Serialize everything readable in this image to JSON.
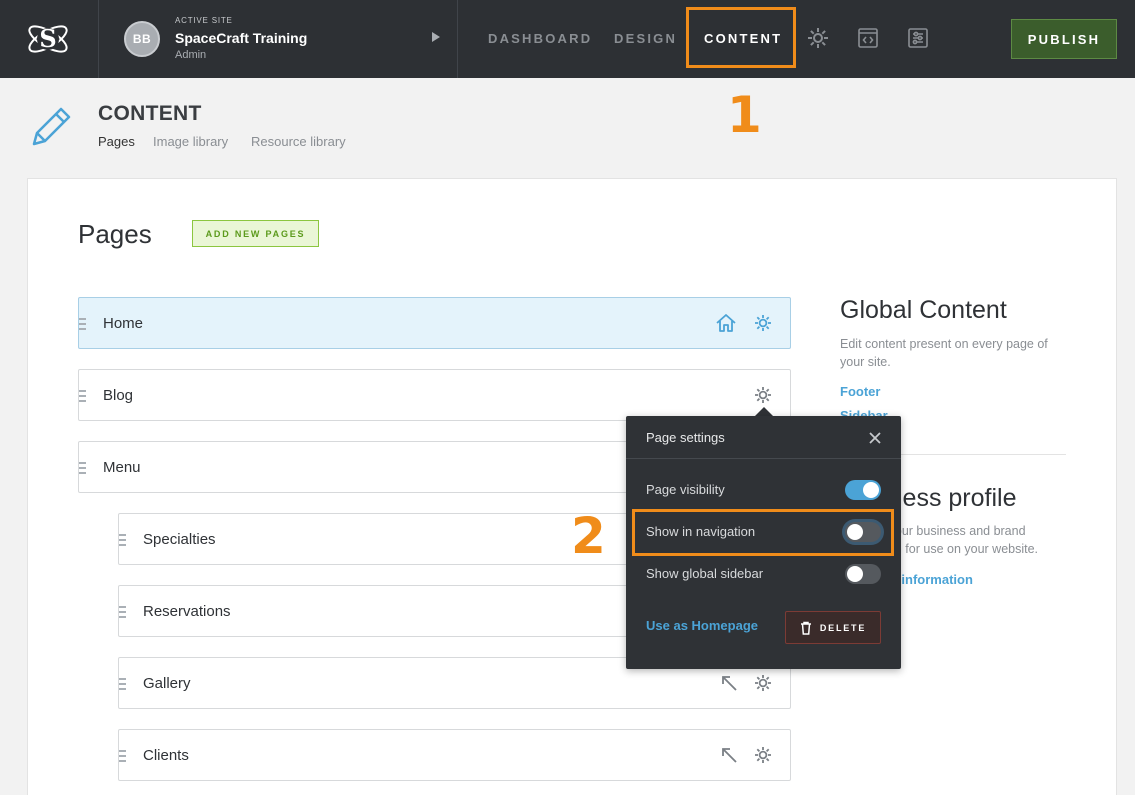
{
  "topbar": {
    "site_eyebrow": "ACTIVE SITE",
    "site_name": "SpaceCraft Training",
    "site_role": "Admin",
    "avatar_initials": "BB",
    "nav": [
      {
        "label": "DASHBOARD",
        "active": false
      },
      {
        "label": "DESIGN",
        "active": false
      },
      {
        "label": "CONTENT",
        "active": true
      }
    ],
    "icons": [
      "gear-icon",
      "code-window-icon",
      "sliders-icon"
    ],
    "publish_label": "PUBLISH"
  },
  "header": {
    "title": "CONTENT",
    "subtabs": [
      {
        "label": "Pages",
        "active": true
      },
      {
        "label": "Image library",
        "active": false
      },
      {
        "label": "Resource library",
        "active": false
      }
    ]
  },
  "callouts": {
    "one": "1",
    "two": "2"
  },
  "pages_section": {
    "heading": "Pages",
    "add_button": "ADD NEW PAGES",
    "pages": [
      {
        "label": "Home",
        "level": 0,
        "is_home": true,
        "icons": [
          "home-icon",
          "gear-icon"
        ]
      },
      {
        "label": "Blog",
        "level": 0,
        "icons": [
          "gear-icon"
        ]
      },
      {
        "label": "Menu",
        "level": 0,
        "icons": []
      },
      {
        "label": "Specialties",
        "level": 1,
        "icons": []
      },
      {
        "label": "Reservations",
        "level": 1,
        "icons": []
      },
      {
        "label": "Gallery",
        "level": 1,
        "icons": [
          "external-arrow-icon",
          "gear-icon"
        ]
      },
      {
        "label": "Clients",
        "level": 1,
        "icons": [
          "external-arrow-icon",
          "gear-icon"
        ]
      }
    ]
  },
  "global_content": {
    "title": "Global Content",
    "description": "Edit content present on every page of your site.",
    "links": [
      "Footer",
      "Sidebar"
    ]
  },
  "business_profile": {
    "title": "Business profile",
    "description": "Manage your business and brand information for use on your website.",
    "link": "Business information"
  },
  "page_settings": {
    "title": "Page settings",
    "options": [
      {
        "label": "Page visibility",
        "on": true
      },
      {
        "label": "Show in navigation",
        "on": false
      },
      {
        "label": "Show global sidebar",
        "on": false
      }
    ],
    "use_homepage": "Use as Homepage",
    "delete_label": "DELETE"
  },
  "colors": {
    "topbar_bg": "#2d3034",
    "accent_blue": "#4ba3d6",
    "highlight_orange": "#f08c1a",
    "publish_green": "#3b5d2c",
    "add_green": "#8cc63f"
  }
}
